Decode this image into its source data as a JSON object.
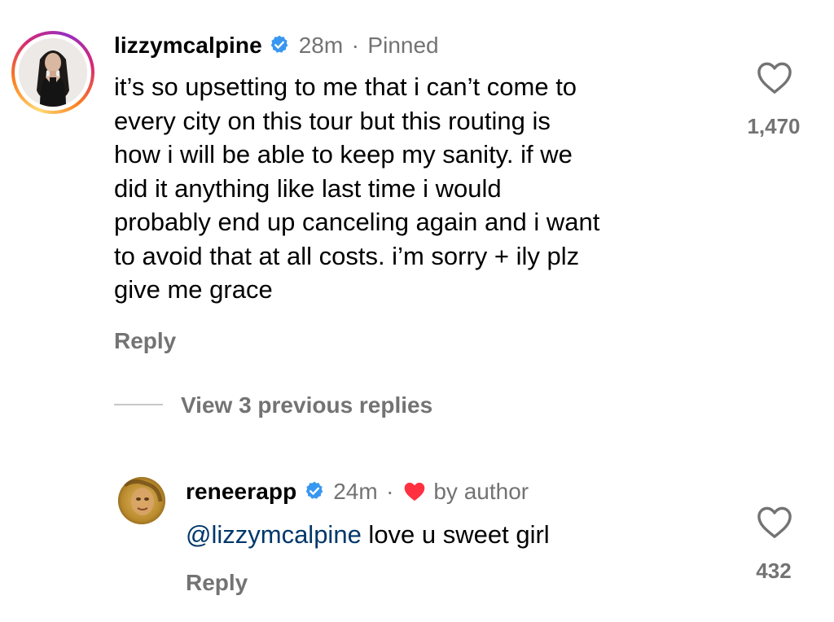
{
  "comment_main": {
    "username": "lizzymcalpine",
    "time": "28m",
    "separator": "·",
    "pinned": "Pinned",
    "text": "it’s so upsetting to me that i can’t come to\nevery city on this tour but this routing is\nhow i will be able to keep my sanity. if we\ndid it anything like last time i would\nprobably end up canceling again and i want\nto avoid that at all costs. i’m sorry + ily plz\ngive me grace",
    "reply_label": "Reply",
    "like_count": "1,470"
  },
  "thread": {
    "view_replies_label": "View 3 previous replies"
  },
  "comment_reply": {
    "username": "reneerapp",
    "time": "24m",
    "separator": "·",
    "liked_by_author": "by author",
    "mention": "@lizzymcalpine",
    "text": " love u sweet girl",
    "reply_label": "Reply",
    "like_count": "432"
  },
  "colors": {
    "verified_badge": "#3897f0",
    "author_heart": "#ff3040",
    "mention": "#00376b",
    "secondary_text": "#737373"
  },
  "icons": {
    "verified": "verified-badge-icon",
    "like": "heart-outline-icon",
    "author_like": "heart-filled-icon"
  }
}
